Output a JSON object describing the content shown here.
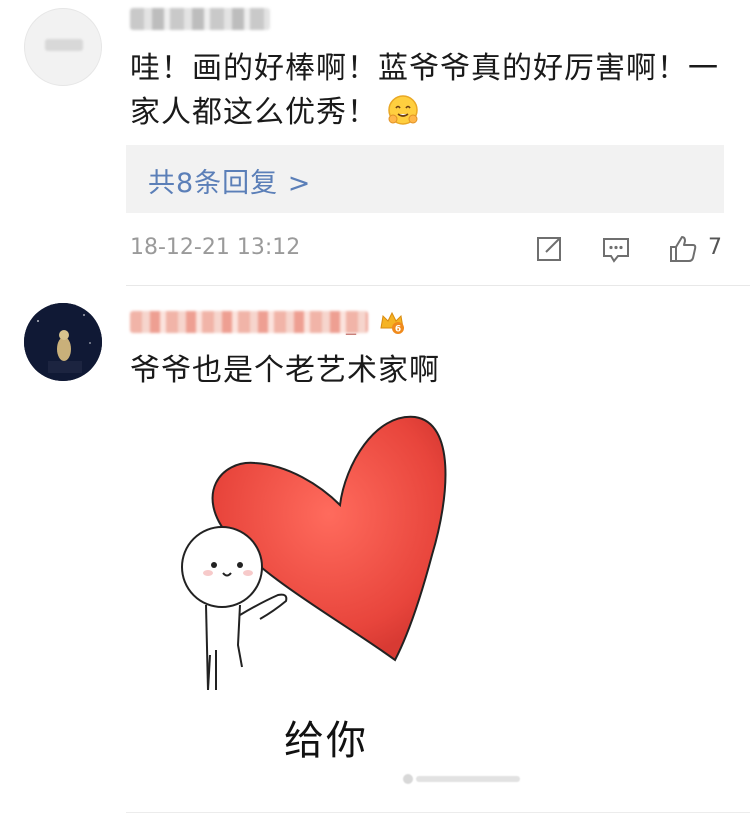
{
  "comments": [
    {
      "text_line1": "哇！画的好棒啊！蓝爷爷真的好厉害啊！一",
      "text_line2": "家人都这么优秀！",
      "emoji": "hugging-face-emoji",
      "replies_label": "共8条回复 >",
      "timestamp": "18-12-21 13:12",
      "likes": "7"
    },
    {
      "name_suffix": "_",
      "badge": "crown-badge",
      "text": "爷爷也是个老艺术家啊",
      "sticker_caption": "给你"
    }
  ],
  "colors": {
    "link": "#5b7fb8",
    "meta": "#9a9a9a",
    "reply_bg": "#f2f2f2",
    "heart": "#e8453c"
  },
  "icons": [
    "share-icon",
    "comment-icon",
    "like-icon"
  ]
}
